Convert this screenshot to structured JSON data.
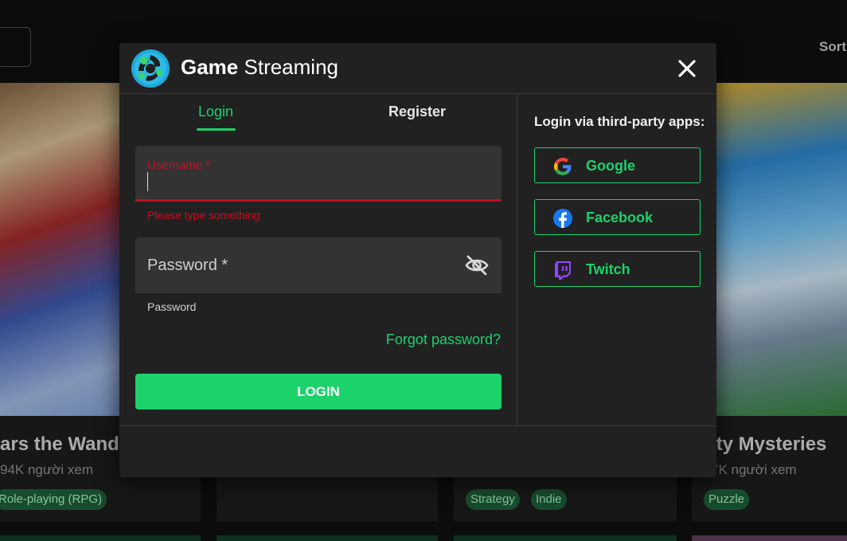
{
  "background": {
    "sort_label": "Sorti",
    "cards": [
      {
        "title": "ars the Wande",
        "views": "94K người xem",
        "tags": [
          "Role-playing (RPG)"
        ]
      },
      {
        "title": "",
        "views": "",
        "tags": []
      },
      {
        "title": "",
        "views": "",
        "tags": [
          "Strategy",
          "Indie"
        ]
      },
      {
        "title": "ity Mysteries",
        "views": "7K người xem",
        "tags": [
          "Puzzle"
        ]
      }
    ]
  },
  "modal": {
    "title_bold": "Game",
    "title_rest": "Streaming",
    "tabs": [
      {
        "label": "Login",
        "active": true
      },
      {
        "label": "Register",
        "active": false
      }
    ],
    "username": {
      "label": "Username *",
      "value": "",
      "error": "Please type something"
    },
    "password": {
      "label": "Password *",
      "hint": "Password"
    },
    "forgot_label": "Forgot password?",
    "login_button": "LOGIN",
    "third_party_title": "Login via third-party apps:",
    "providers": [
      {
        "label": "Google",
        "icon": "google-icon"
      },
      {
        "label": "Facebook",
        "icon": "facebook-icon"
      },
      {
        "label": "Twitch",
        "icon": "twitch-icon"
      }
    ]
  },
  "colors": {
    "accent": "#1bd26b",
    "error": "#c1121f",
    "modal_bg": "#212121",
    "field_bg": "#333333"
  }
}
